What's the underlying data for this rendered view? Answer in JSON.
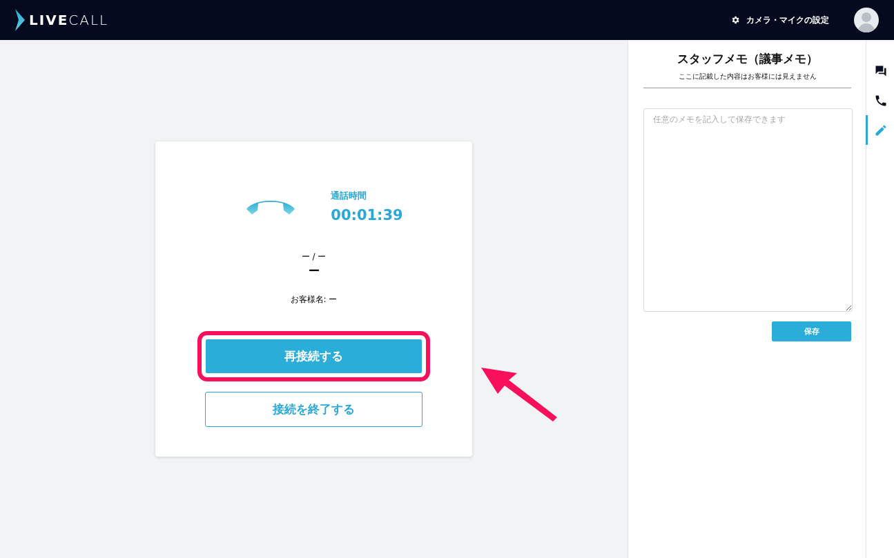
{
  "header": {
    "logo": "**LIVE**CALL",
    "settings_label": "カメラ・マイクの設定"
  },
  "call_card": {
    "duration_label": "通話時間",
    "duration": "00:01:39",
    "line_1": "ー / ー",
    "line_2": "ー",
    "customer": "お客様名: ー",
    "buttons": [
      {
        "label": "再接続する",
        "kind": "primary",
        "highlighted": true
      },
      {
        "label": "接続を終了する",
        "kind": "outline",
        "highlighted": false
      }
    ]
  },
  "memo_panel": {
    "title": "スタッフメモ（議事メモ）",
    "subtitle": "ここに記載した内容はお客様には見えません",
    "placeholder": "任意のメモを記入して保存できます",
    "save_button": "保存"
  },
  "side_tabs": [
    {
      "kind": "chat",
      "selected": false
    },
    {
      "kind": "phone",
      "selected": false
    },
    {
      "kind": "memo",
      "selected": true
    }
  ]
}
